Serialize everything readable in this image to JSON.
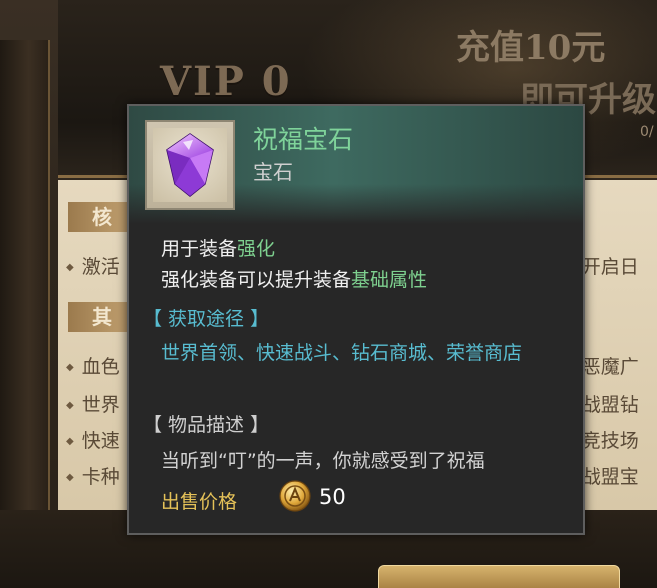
{
  "background": {
    "vip_label": "VIP 0",
    "recharge_text": "充值10元",
    "upgrade_text": "即可升级",
    "progress_text": "0/",
    "section_core": "核",
    "section_other": "其",
    "left_rows": [
      "激活",
      "血色",
      "世界",
      "快速",
      "卡种"
    ],
    "right_rows": [
      "开启日",
      "恶魔广",
      "战盟钻",
      "竞技场",
      "战盟宝"
    ]
  },
  "tooltip": {
    "item_name": "祝福宝石",
    "item_type": "宝石",
    "usage_prefix": "用于装备",
    "usage_highlight": "强化",
    "effect_prefix": "强化装备可以提升装备",
    "effect_highlight": "基础属性",
    "acquire_title": "【 获取途径 】",
    "acquire_sources": "世界首领、快速战斗、钻石商城、荣誉商店",
    "desc_title": "【 物品描述 】",
    "desc_text": "当听到“叮”的一声，你就感受到了祝福",
    "price_label": "出售价格",
    "price_value": "50"
  },
  "colors": {
    "item_name": "#7fd39a",
    "highlight": "#7ed08f",
    "acquire": "#58bcd0",
    "price_label": "#e4c158"
  },
  "icons": {
    "item": "purple-gem-icon",
    "currency": "gold-coin-icon"
  }
}
